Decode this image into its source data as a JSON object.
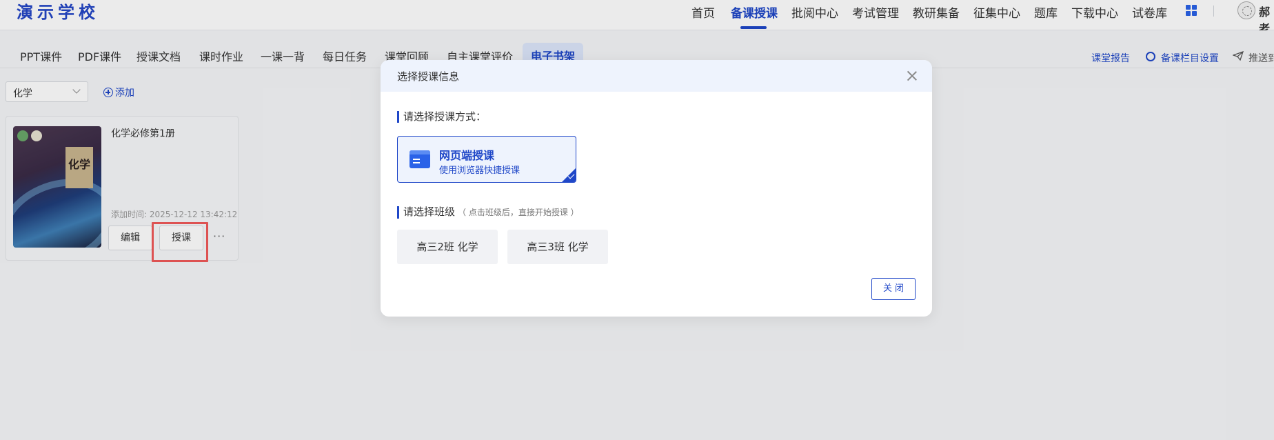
{
  "header": {
    "logo": "演示学校",
    "nav": [
      "首页",
      "备课授课",
      "批阅中心",
      "考试管理",
      "教研集备",
      "征集中心",
      "题库",
      "下载中心",
      "试卷库"
    ],
    "active_nav": "备课授课",
    "username": "郝老"
  },
  "subtabs": {
    "items": [
      "PPT课件",
      "PDF课件",
      "授课文档",
      "课时作业",
      "一课一背",
      "每日任务",
      "课堂回顾",
      "自主课堂评价",
      "电子书架"
    ],
    "active": "电子书架",
    "right_links": [
      "课堂报告",
      "备课栏目设置",
      "推送到"
    ]
  },
  "filter": {
    "subject": "化学",
    "add_label": "添加"
  },
  "book": {
    "name": "化学必修第1册",
    "cover_title": "化学",
    "added_time": "添加时间: 2025-12-12 13:42:12",
    "edit_label": "编辑",
    "teach_label": "授课",
    "more_label": "···"
  },
  "modal": {
    "title": "选择授课信息",
    "mode_section": "请选择授课方式：",
    "mode_title": "网页端授课",
    "mode_subtitle": "使用浏览器快捷授课",
    "class_section": "请选择班级",
    "class_hint": "（ 点击班级后，直接开始授课 ）",
    "classes": [
      "高三2班 化学",
      "高三3班 化学"
    ],
    "close_button": "关闭"
  },
  "colors": {
    "primary": "#1f47c8",
    "highlight": "#f05a5a",
    "modal_header_bg": "#eef3fd"
  }
}
